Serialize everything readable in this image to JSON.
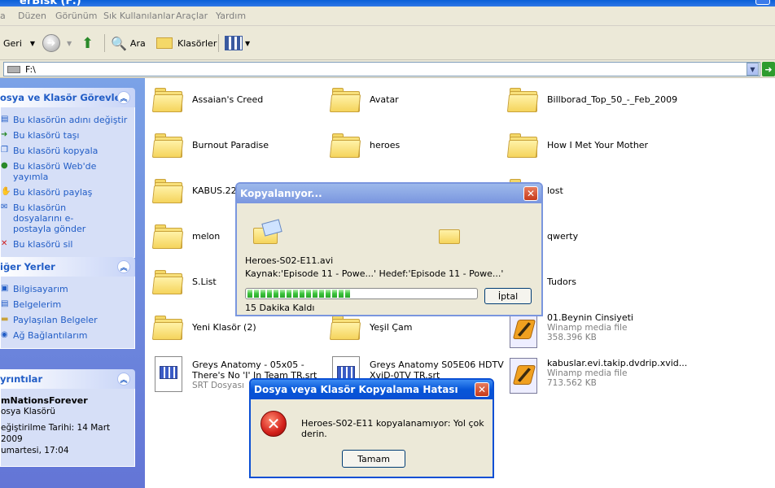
{
  "window": {
    "title": "erBisk (F:)"
  },
  "menu": [
    "a",
    "Düzen",
    "Görünüm",
    "Sık Kullanılanlar",
    "Araçlar",
    "Yardım"
  ],
  "toolbar": {
    "back_label": "Geri",
    "search_label": "Ara",
    "folders_label": "Klasörler"
  },
  "address": {
    "value": "F:\\"
  },
  "tasks_panel": {
    "title": "osya ve Klasör Görevleri",
    "items": [
      "Bu klasörün adını değiştir",
      "Bu klasörü taşı",
      "Bu klasörü kopyala",
      "Bu klasörü Web'de yayımla",
      "Bu klasörü paylaş",
      "Bu klasörün dosyalarını e-postayla gönder",
      "Bu klasörü sil"
    ]
  },
  "other_places": {
    "title": "iğer Yerler",
    "items": [
      "Bilgisayarım",
      "Belgelerim",
      "Paylaşılan Belgeler",
      "Ağ Bağlantılarım"
    ]
  },
  "details": {
    "title": "yrıntılar",
    "name": "mNationsForever",
    "type": "osya Klasörü",
    "modified_label": "eğiştirilme Tarihi: 14 Mart 2009",
    "modified_time": "umartesi, 17:04"
  },
  "files": {
    "col1": [
      "Assaian's Creed",
      "Burnout Paradise",
      "KABUS.22-",
      "melon",
      "S.List",
      "Yeni Klasör (2)"
    ],
    "col2": [
      "Avatar",
      "heroes",
      "Yeşil Çam"
    ],
    "col3": [
      "Billborad_Top_50_-_Feb_2009",
      "How I Met Your Mother",
      "lost",
      "qwerty",
      "Tudors"
    ],
    "srt1": {
      "name1": "Greys Anatomy - 05x05 -",
      "name2": "There's No 'I' In Team TR.srt",
      "type": "SRT Dosyası"
    },
    "srt2": {
      "name1": "Greys Anatomy S05E06 HDTV",
      "name2": "XviD-0TV TR.srt"
    },
    "media1": {
      "name": "01.Beynin Cinsiyeti",
      "type": "Winamp media file",
      "size": "358.396 KB"
    },
    "media2": {
      "name": "kabuslar.evi.takip.dvdrip.xvid...",
      "type": "Winamp media file",
      "size": "713.562 KB"
    }
  },
  "copy_dialog": {
    "title": "Kopyalanıyor...",
    "file": "Heroes-S02-E11.avi",
    "path": "Kaynak:'Episode 11 - Powe...' Hedef:'Episode 11 - Powe...'",
    "remaining": "15 Dakika Kaldı",
    "cancel_label": "İptal",
    "progress": 0.45
  },
  "error_dialog": {
    "title": "Dosya veya Klasör Kopyalama Hatası",
    "message": "Heroes-S02-E11 kopyalanamıyor: Yol çok derin.",
    "ok_label": "Tamam"
  }
}
